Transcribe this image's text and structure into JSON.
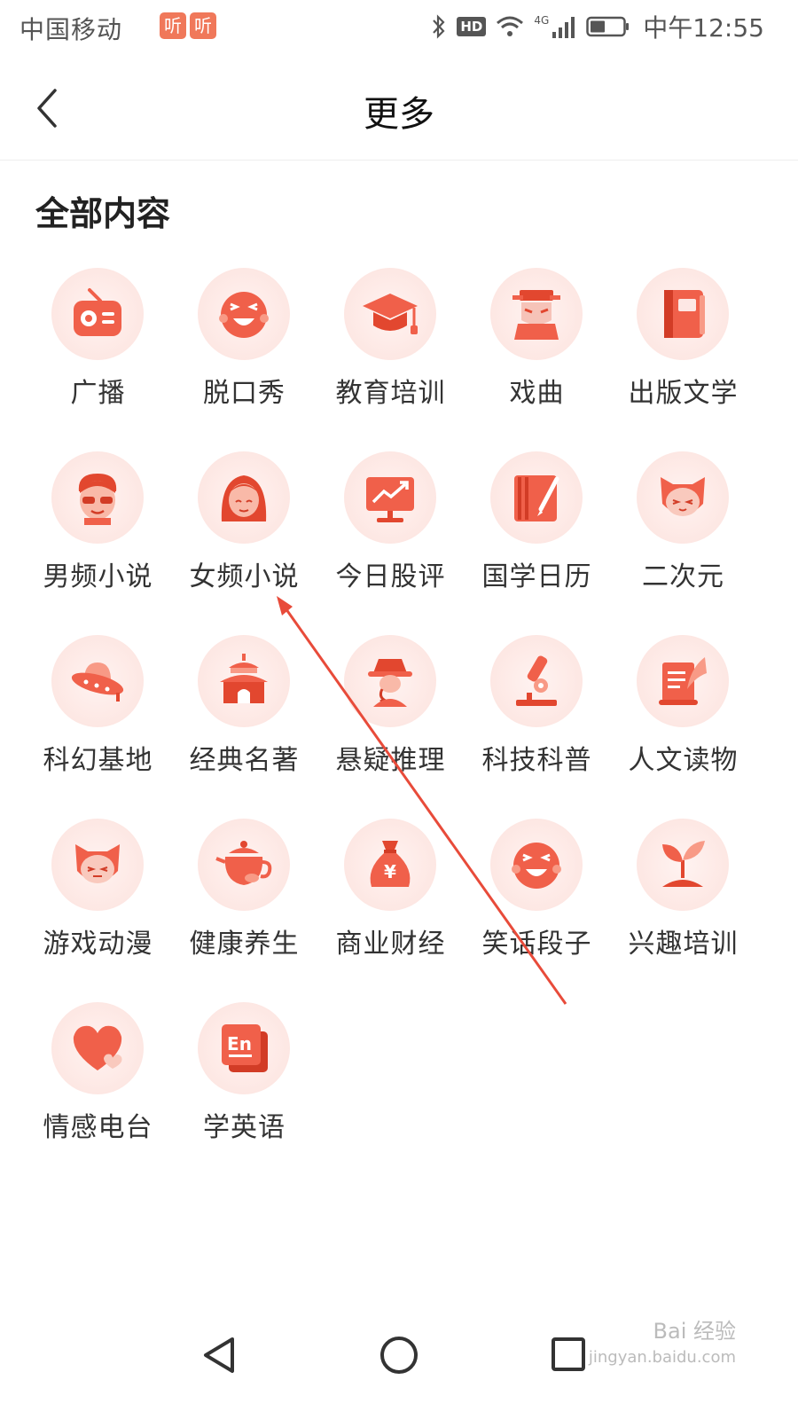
{
  "status_bar": {
    "carrier": "中国移动",
    "tag": "听",
    "network": "4G",
    "time": "中午12:55"
  },
  "header": {
    "title": "更多"
  },
  "section": {
    "title": "全部内容"
  },
  "categories": [
    {
      "label": "广播",
      "icon": "radio-icon"
    },
    {
      "label": "脱口秀",
      "icon": "laughing-face-icon"
    },
    {
      "label": "教育培训",
      "icon": "graduation-cap-icon"
    },
    {
      "label": "戏曲",
      "icon": "opera-mask-icon"
    },
    {
      "label": "出版文学",
      "icon": "book-icon"
    },
    {
      "label": "男频小说",
      "icon": "man-sunglasses-icon"
    },
    {
      "label": "女频小说",
      "icon": "woman-icon"
    },
    {
      "label": "今日股评",
      "icon": "stock-chart-icon"
    },
    {
      "label": "国学日历",
      "icon": "calendar-brush-icon"
    },
    {
      "label": "二次元",
      "icon": "anime-cat-icon"
    },
    {
      "label": "科幻基地",
      "icon": "ufo-icon"
    },
    {
      "label": "经典名著",
      "icon": "temple-icon"
    },
    {
      "label": "悬疑推理",
      "icon": "detective-icon"
    },
    {
      "label": "科技科普",
      "icon": "microscope-icon"
    },
    {
      "label": "人文读物",
      "icon": "scroll-quill-icon"
    },
    {
      "label": "游戏动漫",
      "icon": "game-cat-icon"
    },
    {
      "label": "健康养生",
      "icon": "teapot-icon"
    },
    {
      "label": "商业财经",
      "icon": "money-bag-icon"
    },
    {
      "label": "笑话段子",
      "icon": "grin-face-icon"
    },
    {
      "label": "兴趣培训",
      "icon": "sprout-icon"
    },
    {
      "label": "情感电台",
      "icon": "heart-icon"
    },
    {
      "label": "学英语",
      "icon": "english-card-icon"
    }
  ],
  "english_card_text": "En",
  "money_symbol": "¥",
  "watermark": {
    "main": "Bai 经验",
    "sub": "jingyan.baidu.com"
  },
  "colors": {
    "accent": "#f0604a",
    "accent_light": "#fbe2de",
    "text": "#333333"
  }
}
